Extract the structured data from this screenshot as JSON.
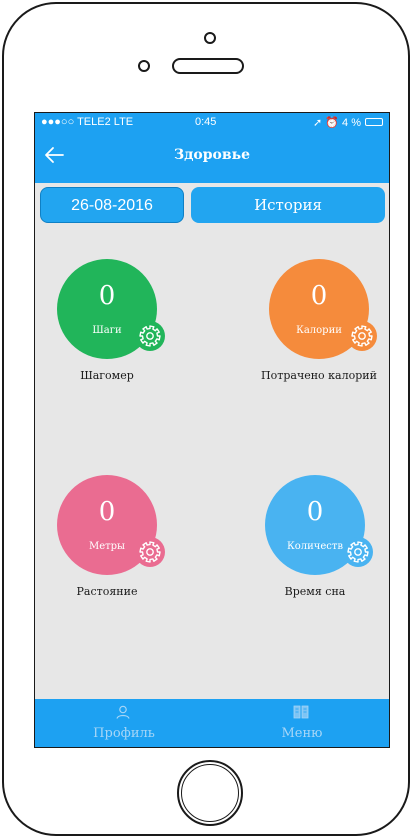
{
  "status_bar": {
    "carrier": "●●●○○ TELE2  LTE",
    "time": "0:45",
    "right": "➚ ⏰ 4 %"
  },
  "nav": {
    "title": "Здоровье",
    "back_icon": "back-arrow-icon"
  },
  "date_button": "26-08-2016",
  "history_button": "История",
  "tiles": [
    {
      "value": "0",
      "unit": "Шаги",
      "caption": "Шагомер",
      "color": "#21b55a"
    },
    {
      "value": "0",
      "unit": "Калории",
      "caption": "Потрачено калорий",
      "color": "#f58b3c"
    },
    {
      "value": "0",
      "unit": "Метры",
      "caption": "Растояние",
      "color": "#ea6c91"
    },
    {
      "value": "0",
      "unit": "Количеств",
      "caption": "Время сна",
      "color": "#49b3f1"
    }
  ],
  "tabbar": {
    "profile": "Профиль",
    "menu": "Меню"
  }
}
